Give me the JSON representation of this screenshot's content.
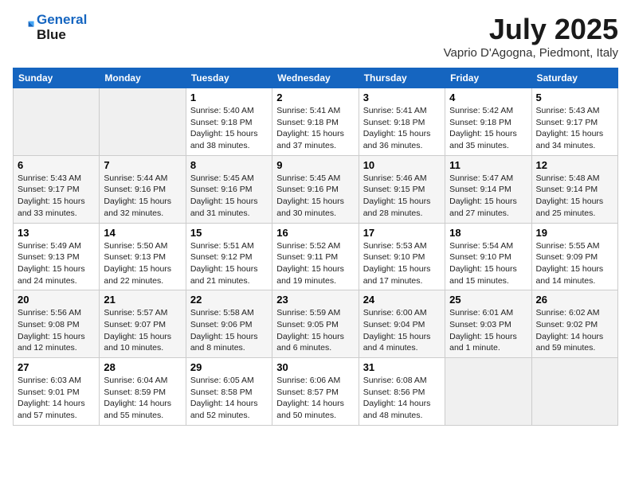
{
  "header": {
    "logo_line1": "General",
    "logo_line2": "Blue",
    "month": "July 2025",
    "location": "Vaprio D'Agogna, Piedmont, Italy"
  },
  "days_of_week": [
    "Sunday",
    "Monday",
    "Tuesday",
    "Wednesday",
    "Thursday",
    "Friday",
    "Saturday"
  ],
  "weeks": [
    [
      {
        "num": "",
        "info": ""
      },
      {
        "num": "",
        "info": ""
      },
      {
        "num": "1",
        "info": "Sunrise: 5:40 AM\nSunset: 9:18 PM\nDaylight: 15 hours\nand 38 minutes."
      },
      {
        "num": "2",
        "info": "Sunrise: 5:41 AM\nSunset: 9:18 PM\nDaylight: 15 hours\nand 37 minutes."
      },
      {
        "num": "3",
        "info": "Sunrise: 5:41 AM\nSunset: 9:18 PM\nDaylight: 15 hours\nand 36 minutes."
      },
      {
        "num": "4",
        "info": "Sunrise: 5:42 AM\nSunset: 9:18 PM\nDaylight: 15 hours\nand 35 minutes."
      },
      {
        "num": "5",
        "info": "Sunrise: 5:43 AM\nSunset: 9:17 PM\nDaylight: 15 hours\nand 34 minutes."
      }
    ],
    [
      {
        "num": "6",
        "info": "Sunrise: 5:43 AM\nSunset: 9:17 PM\nDaylight: 15 hours\nand 33 minutes."
      },
      {
        "num": "7",
        "info": "Sunrise: 5:44 AM\nSunset: 9:16 PM\nDaylight: 15 hours\nand 32 minutes."
      },
      {
        "num": "8",
        "info": "Sunrise: 5:45 AM\nSunset: 9:16 PM\nDaylight: 15 hours\nand 31 minutes."
      },
      {
        "num": "9",
        "info": "Sunrise: 5:45 AM\nSunset: 9:16 PM\nDaylight: 15 hours\nand 30 minutes."
      },
      {
        "num": "10",
        "info": "Sunrise: 5:46 AM\nSunset: 9:15 PM\nDaylight: 15 hours\nand 28 minutes."
      },
      {
        "num": "11",
        "info": "Sunrise: 5:47 AM\nSunset: 9:14 PM\nDaylight: 15 hours\nand 27 minutes."
      },
      {
        "num": "12",
        "info": "Sunrise: 5:48 AM\nSunset: 9:14 PM\nDaylight: 15 hours\nand 25 minutes."
      }
    ],
    [
      {
        "num": "13",
        "info": "Sunrise: 5:49 AM\nSunset: 9:13 PM\nDaylight: 15 hours\nand 24 minutes."
      },
      {
        "num": "14",
        "info": "Sunrise: 5:50 AM\nSunset: 9:13 PM\nDaylight: 15 hours\nand 22 minutes."
      },
      {
        "num": "15",
        "info": "Sunrise: 5:51 AM\nSunset: 9:12 PM\nDaylight: 15 hours\nand 21 minutes."
      },
      {
        "num": "16",
        "info": "Sunrise: 5:52 AM\nSunset: 9:11 PM\nDaylight: 15 hours\nand 19 minutes."
      },
      {
        "num": "17",
        "info": "Sunrise: 5:53 AM\nSunset: 9:10 PM\nDaylight: 15 hours\nand 17 minutes."
      },
      {
        "num": "18",
        "info": "Sunrise: 5:54 AM\nSunset: 9:10 PM\nDaylight: 15 hours\nand 15 minutes."
      },
      {
        "num": "19",
        "info": "Sunrise: 5:55 AM\nSunset: 9:09 PM\nDaylight: 15 hours\nand 14 minutes."
      }
    ],
    [
      {
        "num": "20",
        "info": "Sunrise: 5:56 AM\nSunset: 9:08 PM\nDaylight: 15 hours\nand 12 minutes."
      },
      {
        "num": "21",
        "info": "Sunrise: 5:57 AM\nSunset: 9:07 PM\nDaylight: 15 hours\nand 10 minutes."
      },
      {
        "num": "22",
        "info": "Sunrise: 5:58 AM\nSunset: 9:06 PM\nDaylight: 15 hours\nand 8 minutes."
      },
      {
        "num": "23",
        "info": "Sunrise: 5:59 AM\nSunset: 9:05 PM\nDaylight: 15 hours\nand 6 minutes."
      },
      {
        "num": "24",
        "info": "Sunrise: 6:00 AM\nSunset: 9:04 PM\nDaylight: 15 hours\nand 4 minutes."
      },
      {
        "num": "25",
        "info": "Sunrise: 6:01 AM\nSunset: 9:03 PM\nDaylight: 15 hours\nand 1 minute."
      },
      {
        "num": "26",
        "info": "Sunrise: 6:02 AM\nSunset: 9:02 PM\nDaylight: 14 hours\nand 59 minutes."
      }
    ],
    [
      {
        "num": "27",
        "info": "Sunrise: 6:03 AM\nSunset: 9:01 PM\nDaylight: 14 hours\nand 57 minutes."
      },
      {
        "num": "28",
        "info": "Sunrise: 6:04 AM\nSunset: 8:59 PM\nDaylight: 14 hours\nand 55 minutes."
      },
      {
        "num": "29",
        "info": "Sunrise: 6:05 AM\nSunset: 8:58 PM\nDaylight: 14 hours\nand 52 minutes."
      },
      {
        "num": "30",
        "info": "Sunrise: 6:06 AM\nSunset: 8:57 PM\nDaylight: 14 hours\nand 50 minutes."
      },
      {
        "num": "31",
        "info": "Sunrise: 6:08 AM\nSunset: 8:56 PM\nDaylight: 14 hours\nand 48 minutes."
      },
      {
        "num": "",
        "info": ""
      },
      {
        "num": "",
        "info": ""
      }
    ]
  ]
}
